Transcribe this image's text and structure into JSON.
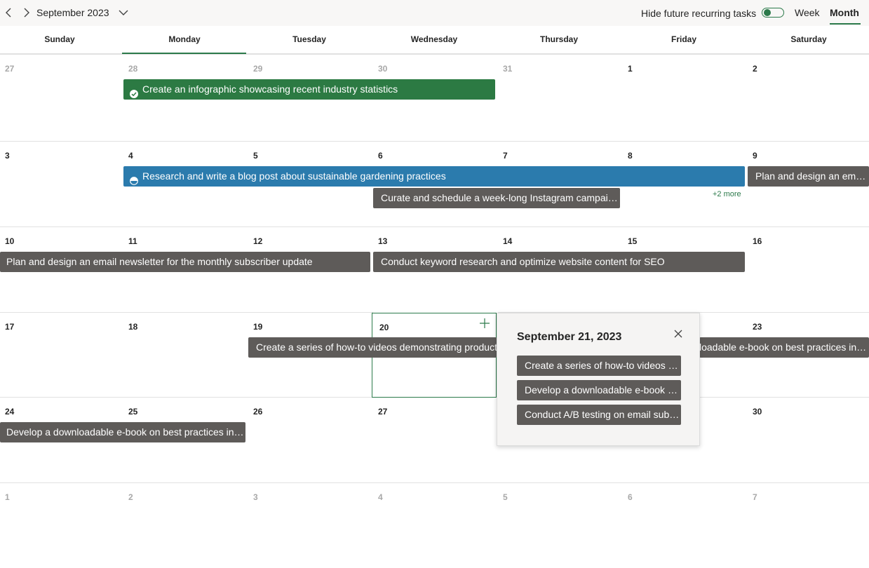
{
  "header": {
    "month_title": "September 2023",
    "hide_recurring_label": "Hide future recurring tasks",
    "hide_recurring_on": true,
    "views": {
      "week": "Week",
      "month": "Month"
    },
    "active_view": "Month",
    "accent_color": "#2c7a4b"
  },
  "weekdays": [
    "Sunday",
    "Monday",
    "Tuesday",
    "Wednesday",
    "Thursday",
    "Friday",
    "Saturday"
  ],
  "weeks": [
    [
      "27",
      "28",
      "29",
      "30",
      "31",
      "1",
      "2"
    ],
    [
      "3",
      "4",
      "5",
      "6",
      "7",
      "8",
      "9"
    ],
    [
      "10",
      "11",
      "12",
      "13",
      "14",
      "15",
      "16"
    ],
    [
      "17",
      "18",
      "19",
      "20",
      "21",
      "22",
      "23"
    ],
    [
      "24",
      "25",
      "26",
      "27",
      "28",
      "29",
      "30"
    ],
    [
      "1",
      "2",
      "3",
      "4",
      "5",
      "6",
      "7"
    ]
  ],
  "events": {
    "infographic": "Create an infographic showcasing recent industry statistics",
    "blog_post": "Research and write a blog post about sustainable gardening practices",
    "email_design_short": "Plan and design an email newsletter for the monthly subscriber update",
    "instagram": "Curate and schedule a week-long Instagram campaign for product launch",
    "more_label": "+2 more",
    "email_newsletter": "Plan and design an email newsletter for the monthly subscriber update",
    "keyword_research": "Conduct keyword research and optimize website content for SEO",
    "howto_videos": "Create a series of how-to videos demonstrating product features",
    "ebook_continued": "loadable e-book on best practices in industry",
    "ebook": "Develop a downloadable e-book on best practices in industry"
  },
  "popup": {
    "date_title": "September 21, 2023",
    "items": [
      "Create a series of how-to videos demonstrating product features",
      "Develop a downloadable e-book on best practices in industry",
      "Conduct A/B testing on email subject lines"
    ]
  }
}
